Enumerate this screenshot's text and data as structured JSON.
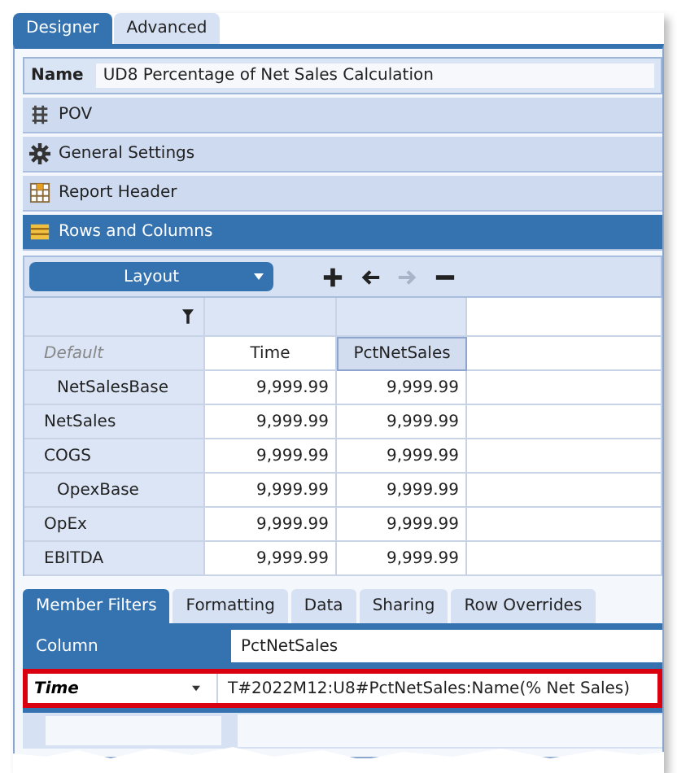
{
  "tabs": [
    {
      "label": "Designer",
      "selected": true
    },
    {
      "label": "Advanced",
      "selected": false
    }
  ],
  "name": {
    "label": "Name",
    "value": "UD8 Percentage of Net Sales Calculation"
  },
  "sections": [
    {
      "label": "POV",
      "kind": "pov",
      "selected": false
    },
    {
      "label": "General Settings",
      "kind": "gear",
      "selected": false
    },
    {
      "label": "Report Header",
      "kind": "header",
      "selected": false
    },
    {
      "label": "Rows and Columns",
      "kind": "rows",
      "selected": true
    }
  ],
  "toolbar": {
    "dropdown": "Layout",
    "buttons": [
      {
        "kind": "plus",
        "disabled": false
      },
      {
        "kind": "left",
        "disabled": false
      },
      {
        "kind": "right",
        "disabled": true
      },
      {
        "kind": "minus",
        "disabled": false
      }
    ]
  },
  "grid": {
    "corner": "Default",
    "columns": [
      {
        "label": "Time",
        "selected": false
      },
      {
        "label": "PctNetSales",
        "selected": true
      }
    ],
    "rows": [
      {
        "label": "NetSalesBase",
        "kind": "base",
        "values": [
          "9,999.99",
          "9,999.99"
        ]
      },
      {
        "label": "NetSales",
        "kind": "member",
        "values": [
          "9,999.99",
          "9,999.99"
        ]
      },
      {
        "label": "COGS",
        "kind": "member",
        "values": [
          "9,999.99",
          "9,999.99"
        ]
      },
      {
        "label": "OpexBase",
        "kind": "base",
        "values": [
          "9,999.99",
          "9,999.99"
        ]
      },
      {
        "label": "OpEx",
        "kind": "member",
        "values": [
          "9,999.99",
          "9,999.99"
        ]
      },
      {
        "label": "EBITDA",
        "kind": "member",
        "values": [
          "9,999.99",
          "9,999.99"
        ]
      }
    ]
  },
  "filter_tabs": [
    {
      "label": "Member Filters",
      "selected": true
    },
    {
      "label": "Formatting",
      "selected": false
    },
    {
      "label": "Data",
      "selected": false
    },
    {
      "label": "Sharing",
      "selected": false
    },
    {
      "label": "Row Overrides",
      "selected": false
    }
  ],
  "filters": [
    {
      "kind": "heading",
      "label": "Column",
      "value": "PctNetSales",
      "highlighted": false
    },
    {
      "kind": "dropdown",
      "label": "Time",
      "value": "T#2022M12:U8#PctNetSales:Name(% Net Sales)",
      "highlighted": true
    }
  ]
}
